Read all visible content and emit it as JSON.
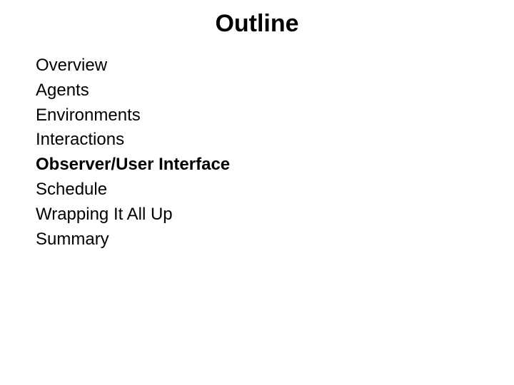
{
  "slide": {
    "title": "Outline",
    "items": [
      {
        "label": "Overview",
        "current": false
      },
      {
        "label": "Agents",
        "current": false
      },
      {
        "label": "Environments",
        "current": false
      },
      {
        "label": "Interactions",
        "current": false
      },
      {
        "label": "Observer/User Interface",
        "current": true
      },
      {
        "label": "Schedule",
        "current": false
      },
      {
        "label": "Wrapping It All Up",
        "current": false
      },
      {
        "label": "Summary",
        "current": false
      }
    ]
  }
}
